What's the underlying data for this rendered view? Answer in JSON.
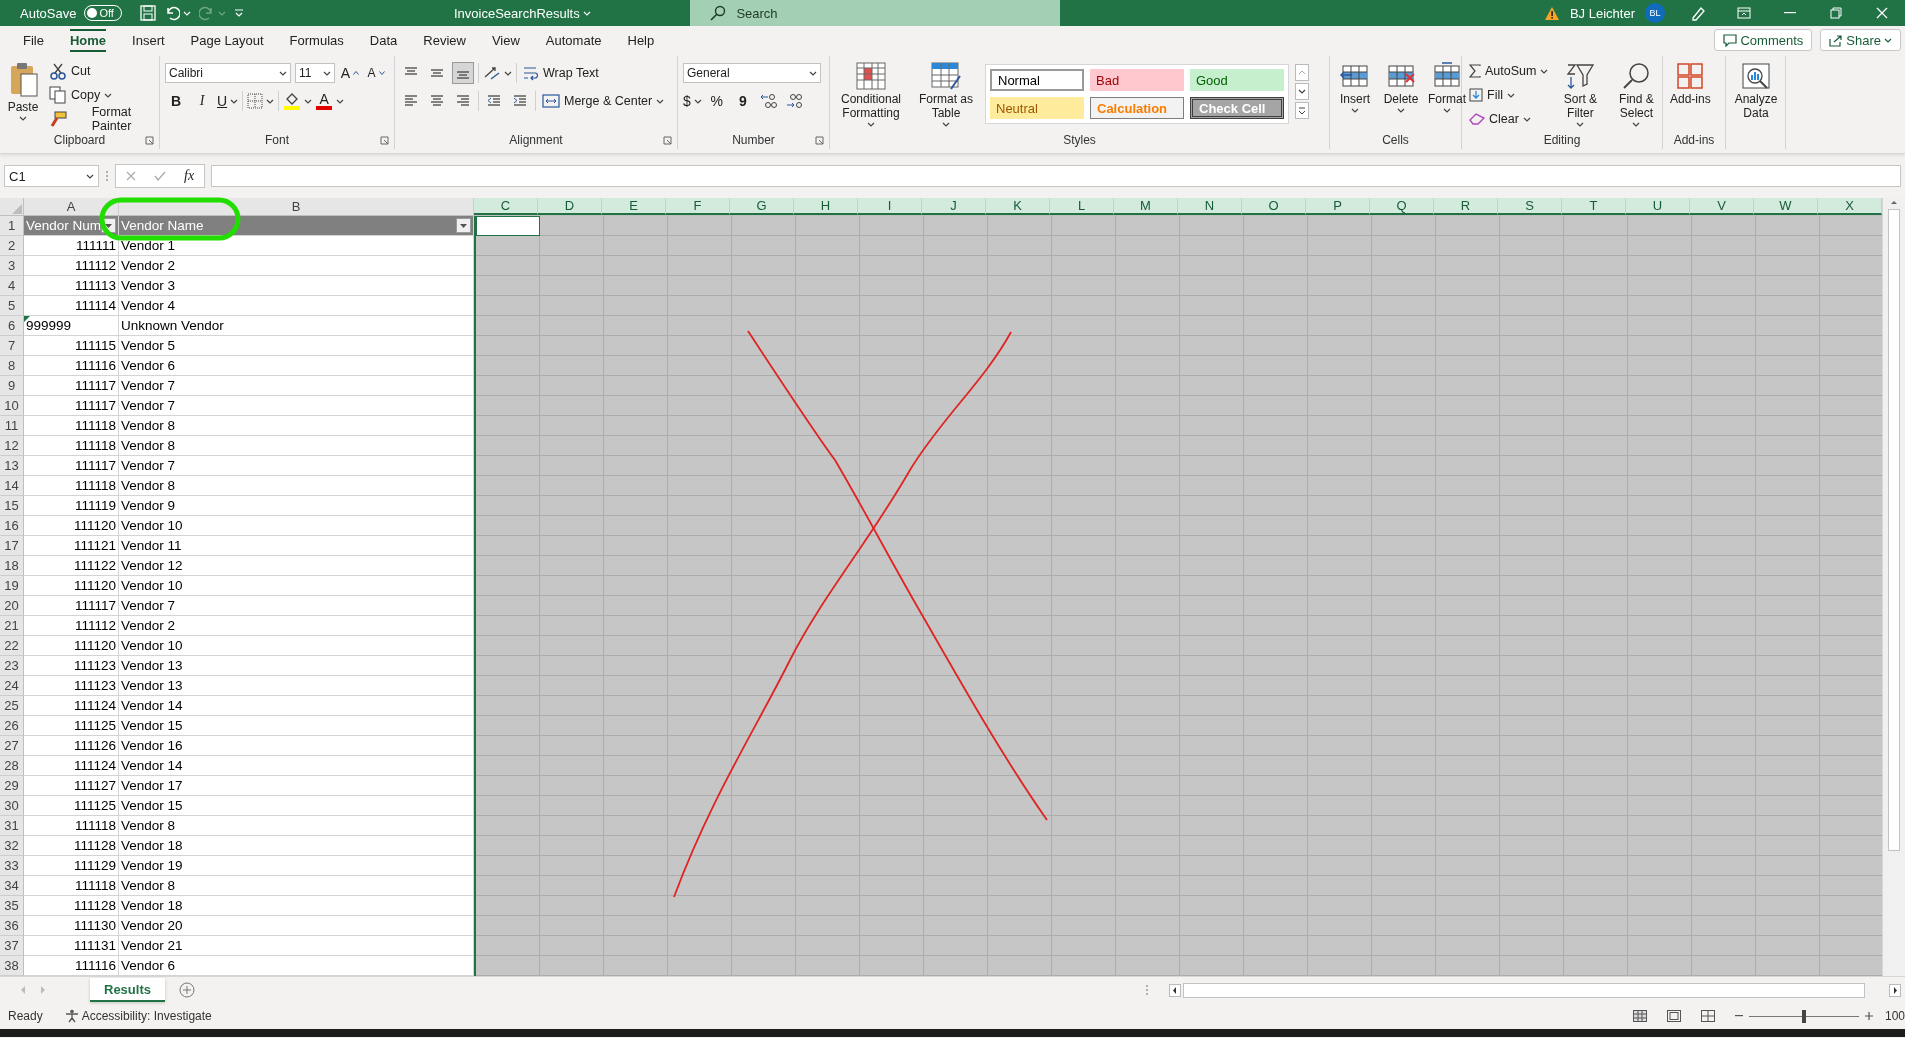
{
  "title_bar": {
    "autosave_label": "AutoSave",
    "autosave_toggle": {
      "label": "Off",
      "on": false
    },
    "title": "InvoiceSearchResults",
    "search": {
      "placeholder": "Search"
    },
    "user_name": "BJ Leichter",
    "avatar": "BL"
  },
  "ribbon_tabs": [
    {
      "label": "File",
      "selected": false
    },
    {
      "label": "Home",
      "selected": true
    },
    {
      "label": "Insert",
      "selected": false
    },
    {
      "label": "Page Layout",
      "selected": false
    },
    {
      "label": "Formulas",
      "selected": false
    },
    {
      "label": "Data",
      "selected": false
    },
    {
      "label": "Review",
      "selected": false
    },
    {
      "label": "View",
      "selected": false
    },
    {
      "label": "Automate",
      "selected": false
    },
    {
      "label": "Help",
      "selected": false
    }
  ],
  "comments_button": "Comments",
  "share_button": "Share",
  "ribbon": {
    "clipboard": {
      "label": "Clipboard",
      "paste": "Paste",
      "cut": "Cut",
      "copy": "Copy",
      "format_painter": "Format Painter"
    },
    "font": {
      "label": "Font",
      "font_name": "Calibri",
      "font_size": "11",
      "grow_font": "A",
      "shrink_font": "A",
      "bold": "B",
      "italic": "I",
      "underline": "U",
      "font_color": "A"
    },
    "alignment": {
      "label": "Alignment",
      "wrap_text": "Wrap Text",
      "merge_center": "Merge & Center"
    },
    "number": {
      "label": "Number",
      "format": "General",
      "currency": "$",
      "percent": "%",
      "comma": "9"
    },
    "styles": {
      "label": "Styles",
      "conditional_formatting": "Conditional Formatting",
      "format_as_table": "Format as Table",
      "cell_styles": [
        {
          "label": "Normal",
          "kind": "normal"
        },
        {
          "label": "Bad",
          "kind": "bad"
        },
        {
          "label": "Good",
          "kind": "good"
        },
        {
          "label": "Neutral",
          "kind": "neutral"
        },
        {
          "label": "Calculation",
          "kind": "calculation"
        },
        {
          "label": "Check Cell",
          "kind": "check"
        }
      ]
    },
    "cells": {
      "label": "Cells",
      "buttons": [
        "Insert",
        "Delete",
        "Format"
      ]
    },
    "editing": {
      "label": "Editing",
      "autosum": "AutoSum",
      "fill": "Fill",
      "clear": "Clear",
      "sort_filter": "Sort & Filter",
      "find_select": "Find & Select"
    },
    "addins": {
      "label": "Add-ins",
      "button": "Add-ins"
    },
    "analyze_data": "Analyze Data"
  },
  "formula_bar": {
    "name_box": "C1",
    "fx": "fx"
  },
  "sheet": {
    "columns": [
      {
        "label": "A",
        "selected": false
      },
      {
        "label": "B",
        "selected": false
      },
      {
        "label": "C",
        "selected": true
      },
      {
        "label": "D",
        "selected": true
      },
      {
        "label": "E",
        "selected": true
      },
      {
        "label": "F",
        "selected": true
      },
      {
        "label": "G",
        "selected": true
      },
      {
        "label": "H",
        "selected": true
      },
      {
        "label": "I",
        "selected": true
      },
      {
        "label": "J",
        "selected": true
      },
      {
        "label": "K",
        "selected": true
      },
      {
        "label": "L",
        "selected": true
      },
      {
        "label": "M",
        "selected": true
      },
      {
        "label": "N",
        "selected": true
      },
      {
        "label": "O",
        "selected": true
      },
      {
        "label": "P",
        "selected": true
      },
      {
        "label": "Q",
        "selected": true
      },
      {
        "label": "R",
        "selected": true
      },
      {
        "label": "S",
        "selected": true
      },
      {
        "label": "T",
        "selected": true
      },
      {
        "label": "U",
        "selected": true
      },
      {
        "label": "V",
        "selected": true
      },
      {
        "label": "W",
        "selected": true
      },
      {
        "label": "X",
        "selected": true
      }
    ],
    "header_row": {
      "row_number": "1",
      "cells": [
        "Vendor Num",
        "Vendor Name"
      ]
    },
    "rows": [
      {
        "row_number": "2",
        "vendor_number": "111111",
        "vendor_name": "Vendor 1",
        "number_stored_as_text": false
      },
      {
        "row_number": "3",
        "vendor_number": "111112",
        "vendor_name": "Vendor 2",
        "number_stored_as_text": false
      },
      {
        "row_number": "4",
        "vendor_number": "111113",
        "vendor_name": "Vendor 3",
        "number_stored_as_text": false
      },
      {
        "row_number": "5",
        "vendor_number": "111114",
        "vendor_name": "Vendor 4",
        "number_stored_as_text": false
      },
      {
        "row_number": "6",
        "vendor_number": "999999",
        "vendor_name": "Unknown Vendor",
        "number_stored_as_text": true
      },
      {
        "row_number": "7",
        "vendor_number": "111115",
        "vendor_name": "Vendor 5",
        "number_stored_as_text": false
      },
      {
        "row_number": "8",
        "vendor_number": "111116",
        "vendor_name": "Vendor 6",
        "number_stored_as_text": false
      },
      {
        "row_number": "9",
        "vendor_number": "111117",
        "vendor_name": "Vendor 7",
        "number_stored_as_text": false
      },
      {
        "row_number": "10",
        "vendor_number": "111117",
        "vendor_name": "Vendor 7",
        "number_stored_as_text": false
      },
      {
        "row_number": "11",
        "vendor_number": "111118",
        "vendor_name": "Vendor 8",
        "number_stored_as_text": false
      },
      {
        "row_number": "12",
        "vendor_number": "111118",
        "vendor_name": "Vendor 8",
        "number_stored_as_text": false
      },
      {
        "row_number": "13",
        "vendor_number": "111117",
        "vendor_name": "Vendor 7",
        "number_stored_as_text": false
      },
      {
        "row_number": "14",
        "vendor_number": "111118",
        "vendor_name": "Vendor 8",
        "number_stored_as_text": false
      },
      {
        "row_number": "15",
        "vendor_number": "111119",
        "vendor_name": "Vendor 9",
        "number_stored_as_text": false
      },
      {
        "row_number": "16",
        "vendor_number": "111120",
        "vendor_name": "Vendor 10",
        "number_stored_as_text": false
      },
      {
        "row_number": "17",
        "vendor_number": "111121",
        "vendor_name": "Vendor 11",
        "number_stored_as_text": false
      },
      {
        "row_number": "18",
        "vendor_number": "111122",
        "vendor_name": "Vendor 12",
        "number_stored_as_text": false
      },
      {
        "row_number": "19",
        "vendor_number": "111120",
        "vendor_name": "Vendor 10",
        "number_stored_as_text": false
      },
      {
        "row_number": "20",
        "vendor_number": "111117",
        "vendor_name": "Vendor 7",
        "number_stored_as_text": false
      },
      {
        "row_number": "21",
        "vendor_number": "111112",
        "vendor_name": "Vendor 2",
        "number_stored_as_text": false
      },
      {
        "row_number": "22",
        "vendor_number": "111120",
        "vendor_name": "Vendor 10",
        "number_stored_as_text": false
      },
      {
        "row_number": "23",
        "vendor_number": "111123",
        "vendor_name": "Vendor 13",
        "number_stored_as_text": false
      },
      {
        "row_number": "24",
        "vendor_number": "111123",
        "vendor_name": "Vendor 13",
        "number_stored_as_text": false
      },
      {
        "row_number": "25",
        "vendor_number": "111124",
        "vendor_name": "Vendor 14",
        "number_stored_as_text": false
      },
      {
        "row_number": "26",
        "vendor_number": "111125",
        "vendor_name": "Vendor 15",
        "number_stored_as_text": false
      },
      {
        "row_number": "27",
        "vendor_number": "111126",
        "vendor_name": "Vendor 16",
        "number_stored_as_text": false
      },
      {
        "row_number": "28",
        "vendor_number": "111124",
        "vendor_name": "Vendor 14",
        "number_stored_as_text": false
      },
      {
        "row_number": "29",
        "vendor_number": "111127",
        "vendor_name": "Vendor 17",
        "number_stored_as_text": false
      },
      {
        "row_number": "30",
        "vendor_number": "111125",
        "vendor_name": "Vendor 15",
        "number_stored_as_text": false
      },
      {
        "row_number": "31",
        "vendor_number": "111118",
        "vendor_name": "Vendor 8",
        "number_stored_as_text": false
      },
      {
        "row_number": "32",
        "vendor_number": "111128",
        "vendor_name": "Vendor 18",
        "number_stored_as_text": false
      },
      {
        "row_number": "33",
        "vendor_number": "111129",
        "vendor_name": "Vendor 19",
        "number_stored_as_text": false
      },
      {
        "row_number": "34",
        "vendor_number": "111118",
        "vendor_name": "Vendor 8",
        "number_stored_as_text": false
      },
      {
        "row_number": "35",
        "vendor_number": "111128",
        "vendor_name": "Vendor 18",
        "number_stored_as_text": false
      },
      {
        "row_number": "36",
        "vendor_number": "111130",
        "vendor_name": "Vendor 20",
        "number_stored_as_text": false
      },
      {
        "row_number": "37",
        "vendor_number": "111131",
        "vendor_name": "Vendor 21",
        "number_stored_as_text": false
      },
      {
        "row_number": "38",
        "vendor_number": "111116",
        "vendor_name": "Vendor 6",
        "number_stored_as_text": false
      }
    ]
  },
  "sheet_tabs": [
    {
      "label": "Results",
      "selected": true
    }
  ],
  "status_bar": {
    "status": "Ready",
    "accessibility": "Accessibility: Investigate",
    "zoom_slider": {
      "level": 0.5
    },
    "zoom_label": "100"
  }
}
